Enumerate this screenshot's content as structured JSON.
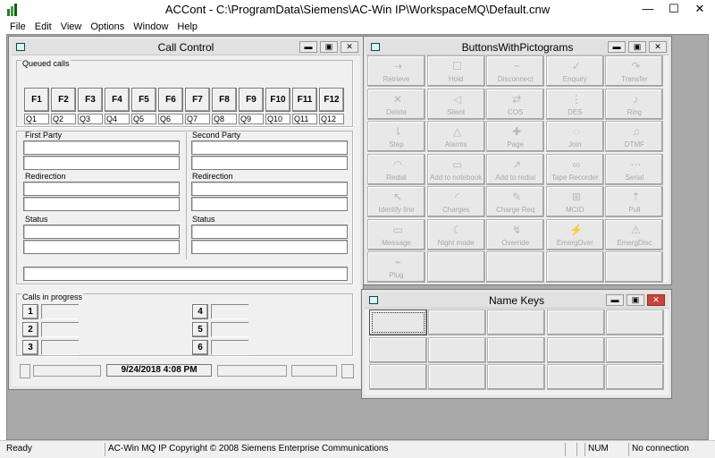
{
  "app": {
    "title": "ACCont - C:\\ProgramData\\Siemens\\AC-Win IP\\WorkspaceMQ\\Default.cnw",
    "minimize": "—",
    "maximize": "☐",
    "close": "✕"
  },
  "menu": [
    "File",
    "Edit",
    "View",
    "Options",
    "Window",
    "Help"
  ],
  "call_control": {
    "title": "Call Control",
    "queued_label": "Queued calls",
    "fkeys": [
      "F1",
      "F2",
      "F3",
      "F4",
      "F5",
      "F6",
      "F7",
      "F8",
      "F9",
      "F10",
      "F11",
      "F12"
    ],
    "queues": [
      "Q1",
      "Q2",
      "Q3",
      "Q4",
      "Q5",
      "Q6",
      "Q7",
      "Q8",
      "Q9",
      "Q10",
      "Q11",
      "Q12"
    ],
    "first_party": "First Party",
    "second_party": "Second Party",
    "redirection_left": "Redirection",
    "redirection_right": "Redirection",
    "status_left": "Status",
    "status_right": "Status",
    "calls_in_progress": "Calls in progress",
    "cip_buttons": [
      "1",
      "2",
      "3",
      "4",
      "5",
      "6"
    ],
    "datetime": "9/24/2018 4:08 PM"
  },
  "pictograms": {
    "title": "ButtonsWithPictograms",
    "buttons": [
      {
        "label": "Retrieve",
        "icon": "⇢"
      },
      {
        "label": "Hold",
        "icon": "☐"
      },
      {
        "label": "Disconnect",
        "icon": "~"
      },
      {
        "label": "Enquiry",
        "icon": "✓"
      },
      {
        "label": "Transfer",
        "icon": "↷"
      },
      {
        "label": "Delete",
        "icon": "✕"
      },
      {
        "label": "Silent",
        "icon": "◁"
      },
      {
        "label": "COS",
        "icon": "⇄"
      },
      {
        "label": "DES",
        "icon": "⋮"
      },
      {
        "label": "Ring",
        "icon": "♪"
      },
      {
        "label": "Step",
        "icon": "⇂"
      },
      {
        "label": "Alarms",
        "icon": "△"
      },
      {
        "label": "Page",
        "icon": "✚"
      },
      {
        "label": "Join",
        "icon": "◌"
      },
      {
        "label": "DTMF",
        "icon": "♫"
      },
      {
        "label": "Redial",
        "icon": "◠"
      },
      {
        "label": "Add to notebook",
        "icon": "▭"
      },
      {
        "label": "Add to redial",
        "icon": "↗"
      },
      {
        "label": "Tape Recorder",
        "icon": "∞"
      },
      {
        "label": "Serial",
        "icon": "⋯"
      },
      {
        "label": "Identify line",
        "icon": "↖"
      },
      {
        "label": "Charges",
        "icon": "◜"
      },
      {
        "label": "Charge Req",
        "icon": "✎"
      },
      {
        "label": "MCID",
        "icon": "⊞"
      },
      {
        "label": "Pull",
        "icon": "⇡"
      },
      {
        "label": "Message",
        "icon": "▭"
      },
      {
        "label": "Night mode",
        "icon": "☾"
      },
      {
        "label": "Override",
        "icon": "↯"
      },
      {
        "label": "EmergOver",
        "icon": "⚡"
      },
      {
        "label": "EmergDisc",
        "icon": "⚠"
      },
      {
        "label": "Plug",
        "icon": "⌁"
      },
      {
        "label": "",
        "icon": ""
      },
      {
        "label": "",
        "icon": ""
      },
      {
        "label": "",
        "icon": ""
      },
      {
        "label": "",
        "icon": ""
      }
    ]
  },
  "name_keys": {
    "title": "Name Keys"
  },
  "status": {
    "ready": "Ready",
    "copyright": "AC-Win MQ IP Copyright © 2008 Siemens Enterprise Communications",
    "num": "NUM",
    "connection": "No connection"
  }
}
